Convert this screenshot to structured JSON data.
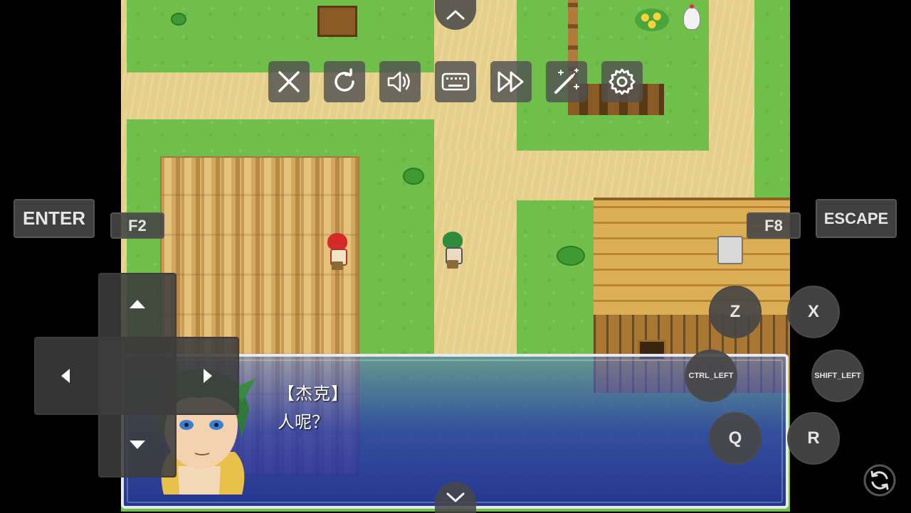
{
  "dialog": {
    "speaker": "【杰克】",
    "line": "人呢？"
  },
  "toolbar": {
    "items": [
      {
        "icon": "close-icon"
      },
      {
        "icon": "refresh-icon"
      },
      {
        "icon": "volume-icon"
      },
      {
        "icon": "keyboard-icon"
      },
      {
        "icon": "fast-forward-icon"
      },
      {
        "icon": "magic-wand-icon"
      },
      {
        "icon": "gear-icon"
      }
    ]
  },
  "keys": {
    "enter": "ENTER",
    "f2": "F2",
    "f8": "F8",
    "escape": "ESCAPE",
    "z": "Z",
    "x": "X",
    "ctrl_left": "CTRL_LEFT",
    "shift_left": "SHIFT_LEFT",
    "q": "Q",
    "r": "R"
  },
  "colors": {
    "dialog_blue": "#2a3a9a",
    "grass": "#6fbf4a",
    "path": "#e6cf8a",
    "overlay_gray": "#505050"
  }
}
